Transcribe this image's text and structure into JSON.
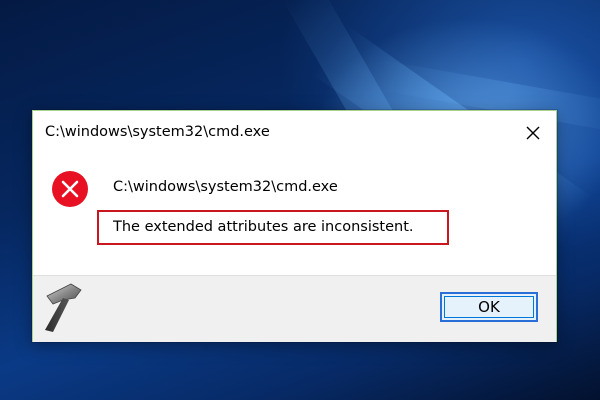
{
  "dialog": {
    "title": "C:\\windows\\system32\\cmd.exe",
    "message_title": "C:\\windows\\system32\\cmd.exe",
    "message_detail": "The extended attributes are inconsistent.",
    "ok_label": "OK",
    "icons": {
      "close": "close-icon",
      "error": "error-icon",
      "logo": "hammer-logo-icon"
    }
  },
  "colors": {
    "error_red": "#e81123",
    "highlight_border": "#c9161f",
    "ok_border": "#2a6fd8",
    "dialog_border": "#a9d18e"
  }
}
